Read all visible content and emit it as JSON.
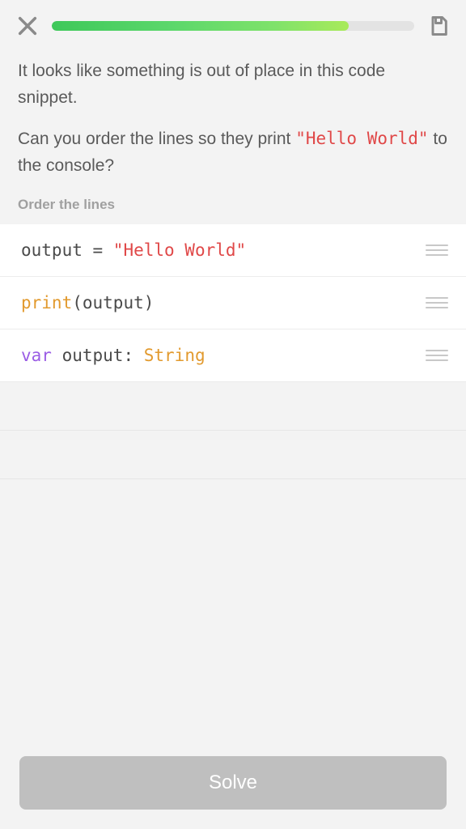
{
  "progress_percent": 82,
  "prompt": {
    "line1": "It looks like something is out of place in this code snippet.",
    "line2_prefix": "Can you order the lines so they print ",
    "line2_code": "\"Hello World\"",
    "line2_suffix": " to the console?"
  },
  "task_label": "Order the lines",
  "code_lines": [
    {
      "tokens": [
        {
          "text": "output",
          "kind": "id"
        },
        {
          "text": " = ",
          "kind": "op"
        },
        {
          "text": "\"Hello World\"",
          "kind": "str"
        }
      ]
    },
    {
      "tokens": [
        {
          "text": "print",
          "kind": "fn"
        },
        {
          "text": "(",
          "kind": "paren"
        },
        {
          "text": "output",
          "kind": "id"
        },
        {
          "text": ")",
          "kind": "paren"
        }
      ]
    },
    {
      "tokens": [
        {
          "text": "var",
          "kind": "kw"
        },
        {
          "text": " ",
          "kind": "op"
        },
        {
          "text": "output",
          "kind": "id"
        },
        {
          "text": ": ",
          "kind": "colon"
        },
        {
          "text": "String",
          "kind": "type"
        }
      ]
    }
  ],
  "placeholder_slots": 2,
  "buttons": {
    "solve": "Solve"
  }
}
